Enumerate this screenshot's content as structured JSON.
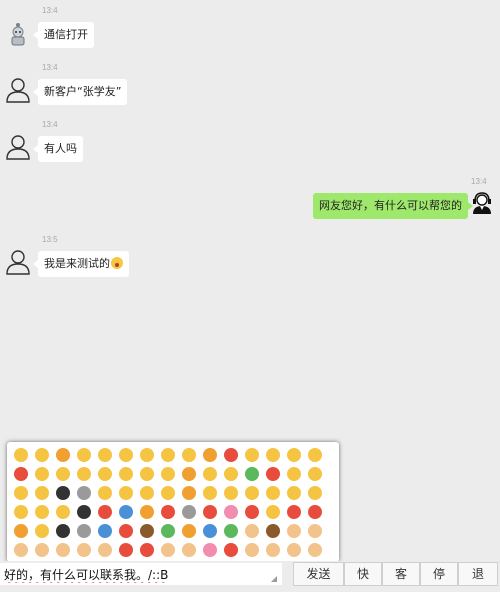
{
  "messages": [
    {
      "time": "13:4",
      "text": "通信打开",
      "avatar": "robot-avatar"
    },
    {
      "time": "13:4",
      "text": "新客户“张学友”",
      "avatar": "person-avatar"
    },
    {
      "time": "13:4",
      "text": "有人吗",
      "avatar": "person-avatar"
    },
    {
      "time": "13:4",
      "text": "网友您好，有什么可以帮您的",
      "avatar": "agent-headset-avatar"
    },
    {
      "time": "13:5",
      "text": "我是来测试的",
      "avatar": "person-avatar",
      "emoji": "surprised-face-emoji"
    }
  ],
  "input": {
    "value": "好的，有什么可以联系我。/::B"
  },
  "buttons": {
    "send": "发送",
    "quick": "快",
    "customer": "客",
    "stop": "停",
    "exit": "退"
  },
  "emoji_panel": {
    "colors": {
      "yellow": "#f6c443",
      "orange": "#f0a030",
      "red": "#e74c3c",
      "green": "#5cb85c",
      "blue": "#4a90d9",
      "brown": "#8b5a2b",
      "pink": "#f28cb1",
      "gray": "#9a9a9a",
      "dark": "#333333",
      "skin": "#f2c38a",
      "purple": "#9b59b6"
    },
    "rows": [
      [
        "yellow",
        "yellow",
        "orange",
        "yellow",
        "yellow",
        "yellow",
        "yellow",
        "yellow",
        "yellow",
        "orange",
        "red",
        "yellow",
        "yellow",
        "yellow",
        "yellow",
        "yellow"
      ],
      [
        "red",
        "yellow",
        "yellow",
        "yellow",
        "yellow",
        "yellow",
        "yellow",
        "yellow",
        "orange",
        "yellow",
        "yellow",
        "green",
        "red",
        "yellow",
        "yellow",
        "yellow"
      ],
      [
        "yellow",
        "yellow",
        "dark",
        "gray",
        "yellow",
        "yellow",
        "yellow",
        "yellow",
        "orange",
        "yellow",
        "yellow",
        "yellow",
        "yellow",
        "yellow",
        "yellow",
        "yellow"
      ],
      [
        "yellow",
        "yellow",
        "yellow",
        "dark",
        "red",
        "blue",
        "orange",
        "red",
        "gray",
        "red",
        "pink",
        "red",
        "yellow",
        "red",
        "red",
        "red"
      ],
      [
        "orange",
        "yellow",
        "dark",
        "gray",
        "blue",
        "red",
        "brown",
        "green",
        "orange",
        "blue",
        "green",
        "skin",
        "brown",
        "skin",
        "skin",
        "skin"
      ],
      [
        "skin",
        "skin",
        "skin",
        "skin",
        "skin",
        "red",
        "red",
        "skin",
        "skin",
        "pink",
        "red",
        "skin",
        "skin",
        "skin",
        "skin"
      ]
    ]
  }
}
